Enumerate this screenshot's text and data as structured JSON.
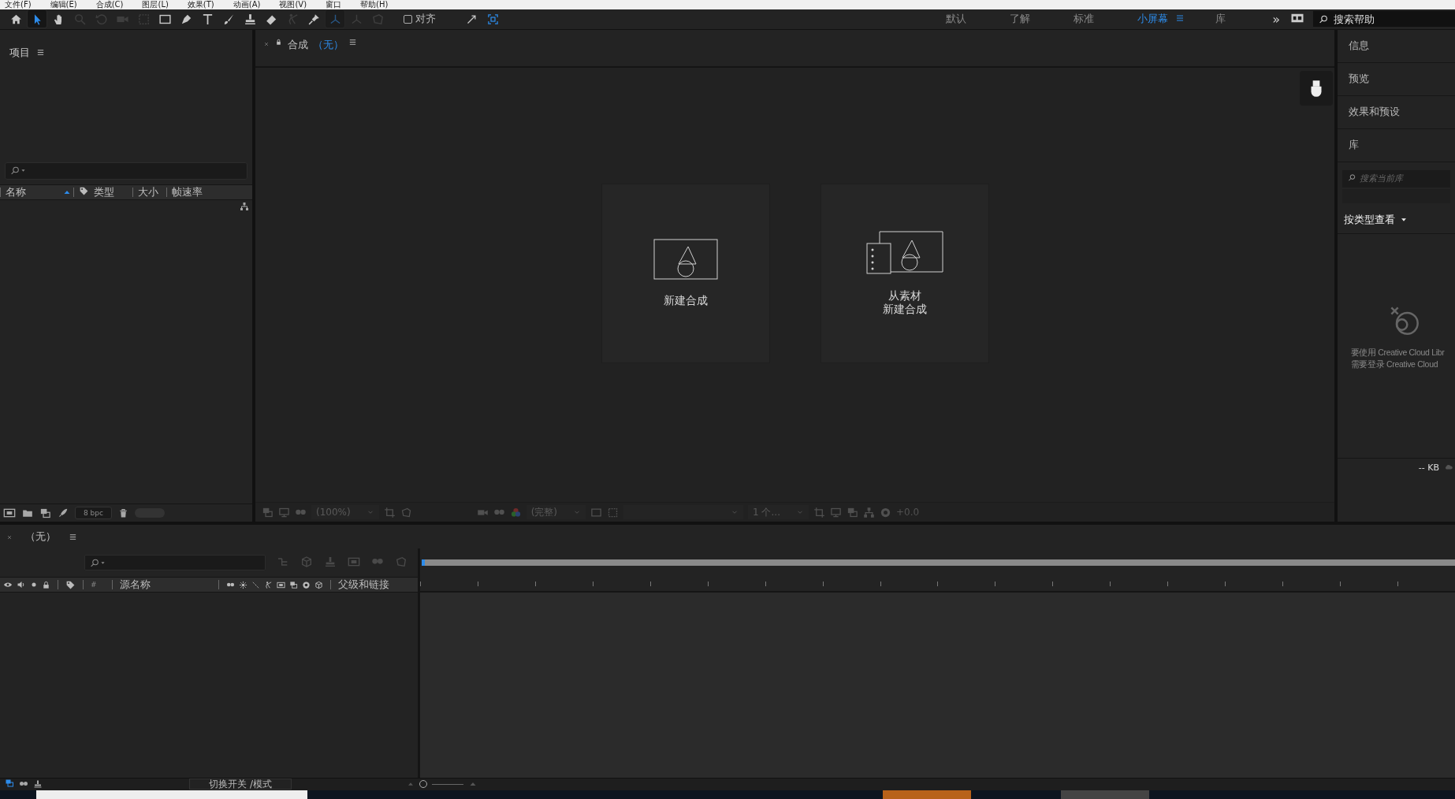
{
  "menu_bar": [
    "文件(F)",
    "编辑(E)",
    "合成(C)",
    "图层(L)",
    "效果(T)",
    "动画(A)",
    "视图(V)",
    "窗口",
    "帮助(H)"
  ],
  "toolbar": {
    "tools": [
      {
        "kind": "home",
        "selected": false,
        "disabled": false
      },
      {
        "kind": "arrow",
        "selected": true,
        "disabled": false
      },
      {
        "kind": "hand",
        "selected": false,
        "disabled": false
      },
      {
        "kind": "magnifier",
        "selected": false,
        "disabled": true
      },
      {
        "kind": "rotate",
        "selected": false,
        "disabled": true
      },
      {
        "kind": "camera",
        "selected": false,
        "disabled": true
      },
      {
        "kind": "dashed-square",
        "selected": false,
        "disabled": true
      },
      {
        "kind": "rectangle",
        "selected": false,
        "disabled": false
      },
      {
        "kind": "pen",
        "selected": false,
        "disabled": false
      },
      {
        "kind": "text",
        "selected": false,
        "disabled": false
      },
      {
        "kind": "brush",
        "selected": false,
        "disabled": false
      },
      {
        "kind": "stamp",
        "selected": false,
        "disabled": false
      },
      {
        "kind": "eraser",
        "selected": false,
        "disabled": false
      },
      {
        "kind": "figure",
        "selected": false,
        "disabled": true
      },
      {
        "kind": "pin",
        "selected": false,
        "disabled": false
      },
      {
        "kind": "axis",
        "selected": true,
        "disabled": true
      },
      {
        "kind": "axis",
        "selected": false,
        "disabled": true
      },
      {
        "kind": "plane",
        "selected": false,
        "disabled": true
      }
    ],
    "snap": {
      "label": "对齐",
      "checked": false
    },
    "workspaces": [
      {
        "label": "默认",
        "selected": false
      },
      {
        "label": "了解",
        "selected": false
      },
      {
        "label": "标准",
        "selected": false
      },
      {
        "label": "小屏幕",
        "selected": true
      },
      {
        "label": "库",
        "selected": false
      }
    ],
    "overflow": "»",
    "search": {
      "placeholder": "搜索帮助"
    }
  },
  "project_panel": {
    "title": "项目",
    "columns": [
      {
        "label": "名称",
        "sorted": true
      },
      {
        "label": "类型",
        "sorted": false
      },
      {
        "label": "大小",
        "sorted": false
      },
      {
        "label": "帧速率",
        "sorted": false
      }
    ],
    "bit_depth": "8 bpc"
  },
  "composition_panel": {
    "tab": "合成",
    "tab_value": "（无）",
    "cards": [
      {
        "kind": "new",
        "lines": [
          "新建合成"
        ]
      },
      {
        "kind": "footage",
        "lines": [
          "从素材",
          "新建合成"
        ]
      }
    ],
    "toolbar": {
      "disabled": true,
      "zoom": "(100%)",
      "resolution": "(完整)",
      "views": "1 个...",
      "exposure": "+0.0"
    }
  },
  "right_panel": {
    "sections": [
      "信息",
      "预览",
      "效果和预设",
      "库"
    ],
    "search": {
      "placeholder": "搜索当前库"
    },
    "view_by": "按类型查看",
    "message": [
      "要使用 Creative Cloud Libr",
      "需要登录 Creative Cloud"
    ],
    "storage": "-- KB"
  },
  "timeline": {
    "tab": "（无）",
    "columns": {
      "number": "#",
      "source_name": "源名称",
      "parent": "父级和链接"
    },
    "toggle_label": "切换开关 /模式"
  }
}
